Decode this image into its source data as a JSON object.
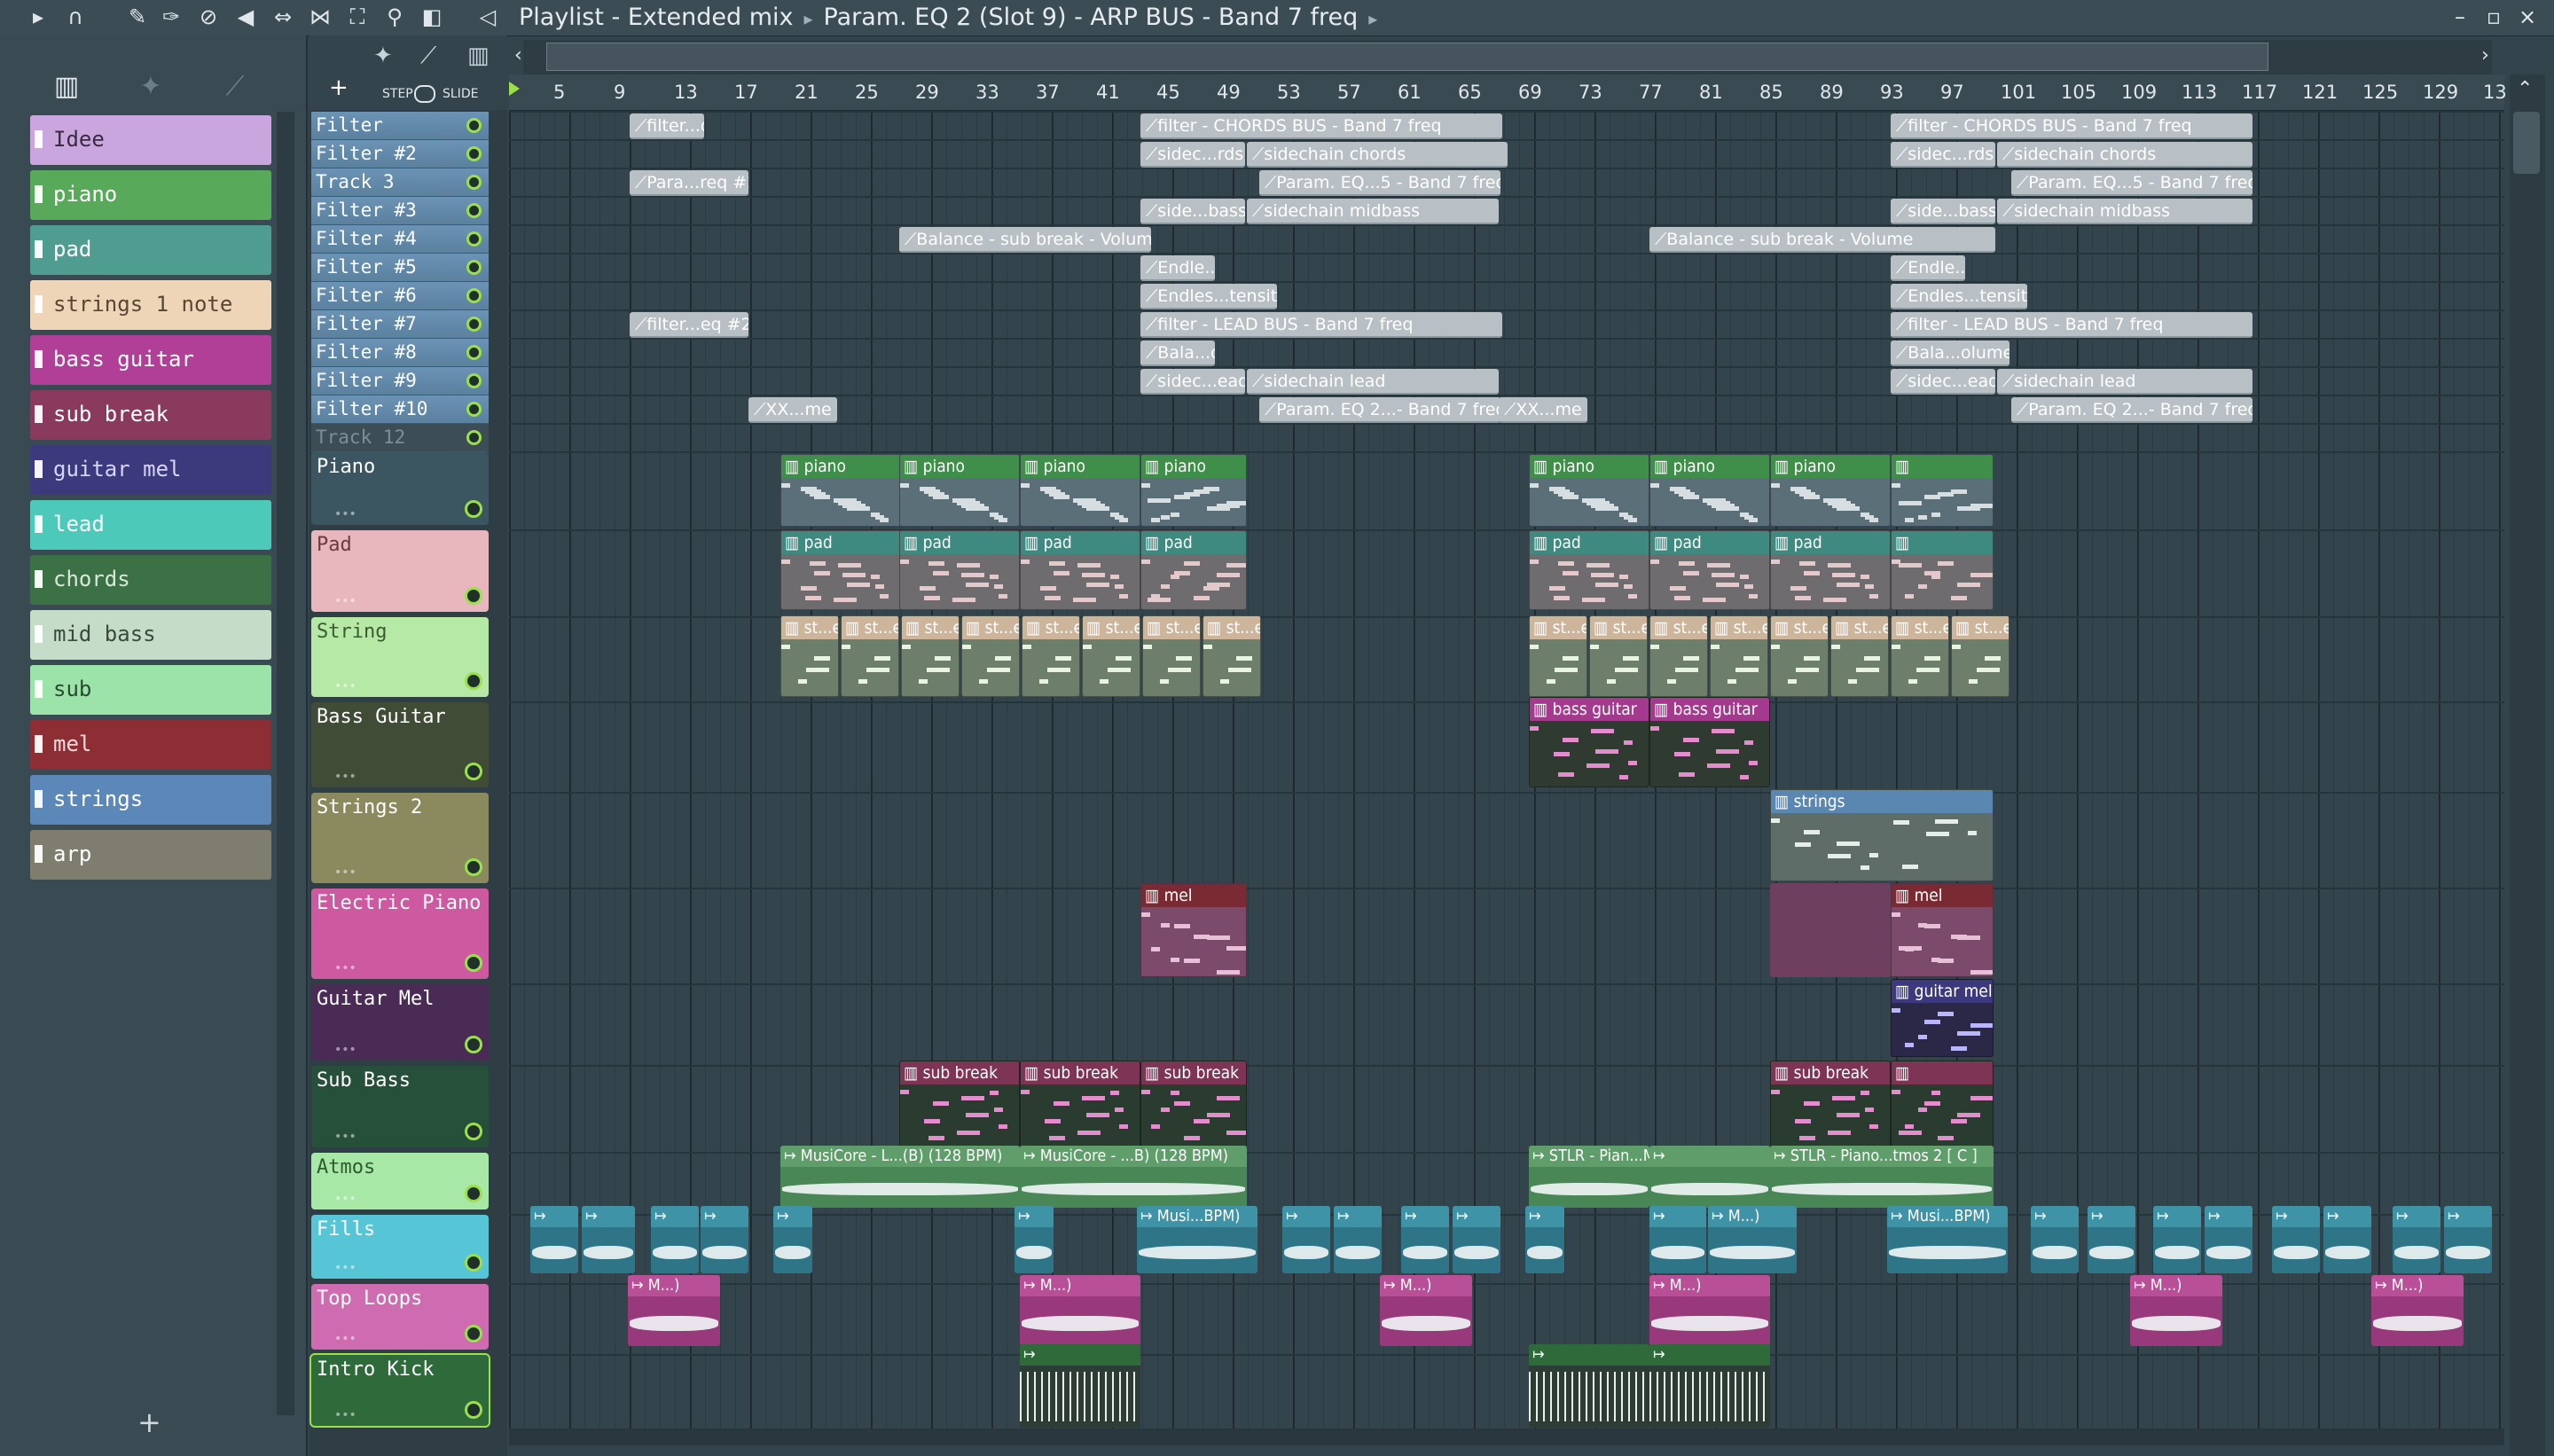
{
  "colors": {
    "accent": "#9be04a",
    "playlist_bg": "#34444d",
    "automation_clip": "#b8c0c6"
  },
  "topbar": {
    "icons": [
      "play-arrow-icon",
      "magnet-icon",
      "pencil-icon",
      "paint-brush-icon",
      "delete-icon",
      "mute-icon",
      "slip-icon",
      "slice-icon",
      "select-icon",
      "zoom-icon",
      "playback-icon",
      "speaker-icon"
    ],
    "title_main": "Playlist - Extended mix",
    "title_path": "Param. EQ 2 (Slot 9) - ARP BUS - Band 7 freq",
    "window": [
      "minimize-icon",
      "maximize-icon",
      "close-icon"
    ]
  },
  "snap": {
    "step_label": "STEP",
    "slide_label": "SLIDE"
  },
  "patterns": [
    {
      "label": "Idee",
      "color": "#c9a6de",
      "text": "#3a2a44"
    },
    {
      "label": "piano",
      "color": "#58a95a",
      "text": "#ffffff"
    },
    {
      "label": "pad",
      "color": "#4f9d91",
      "text": "#ffffff"
    },
    {
      "label": "strings 1 note",
      "color": "#eed5b8",
      "text": "#5a4632"
    },
    {
      "label": "bass guitar",
      "color": "#b13f98",
      "text": "#ffffff"
    },
    {
      "label": "sub break",
      "color": "#8a3a5c",
      "text": "#ffffff"
    },
    {
      "label": "guitar mel",
      "color": "#3c3a7c",
      "text": "#d7d5ff"
    },
    {
      "label": "lead",
      "color": "#4cc9b9",
      "text": "#ffffff"
    },
    {
      "label": "chords",
      "color": "#3c7146",
      "text": "#d7ead9"
    },
    {
      "label": "mid bass",
      "color": "#c5dcc8",
      "text": "#3a4a3d"
    },
    {
      "label": "sub",
      "color": "#9be3a9",
      "text": "#2a4a30"
    },
    {
      "label": "mel",
      "color": "#8d2e35",
      "text": "#ffd9d9"
    },
    {
      "label": "strings",
      "color": "#5b87b9",
      "text": "#ffffff"
    },
    {
      "label": "arp",
      "color": "#7e7d6e",
      "text": "#ffffff"
    }
  ],
  "ruler": [
    "5",
    "9",
    "13",
    "17",
    "21",
    "25",
    "29",
    "33",
    "37",
    "41",
    "45",
    "49",
    "53",
    "57",
    "61",
    "65",
    "69",
    "73",
    "77",
    "81",
    "85",
    "89",
    "93",
    "97",
    "101",
    "105",
    "109",
    "113",
    "117",
    "121",
    "125",
    "129",
    "13"
  ],
  "automation_tracks": [
    "Filter",
    "Filter #2",
    "Track 3",
    "Filter #3",
    "Filter #4",
    "Filter #5",
    "Filter #6",
    "Filter #7",
    "Filter #8",
    "Filter #9",
    "Filter #10",
    "Track 12"
  ],
  "tracks": [
    {
      "name": "Piano",
      "color": "#3b5661",
      "text": "#ffffff"
    },
    {
      "name": "Pad",
      "color": "#e7b7bd",
      "text": "#6a3a40"
    },
    {
      "name": "String",
      "color": "#b6e9a5",
      "text": "#3b5a31"
    },
    {
      "name": "Bass Guitar",
      "color": "#404c35",
      "text": "#ffffff"
    },
    {
      "name": "Strings 2",
      "color": "#8b8a5e",
      "text": "#ffffff"
    },
    {
      "name": "Electric Piano",
      "color": "#cd5aa1",
      "text": "#ffffff"
    },
    {
      "name": "Guitar Mel",
      "color": "#4a2b56",
      "text": "#ffffff"
    },
    {
      "name": "Sub Bass",
      "color": "#27503a",
      "text": "#ffffff"
    },
    {
      "name": "Atmos",
      "color": "#a7e8a7",
      "text": "#2f5a30"
    },
    {
      "name": "Fills",
      "color": "#56c5d6",
      "text": "#ffffff"
    },
    {
      "name": "Top Loops",
      "color": "#cf6bb1",
      "text": "#ffffff"
    },
    {
      "name": "Intro Kick",
      "color": "#2f6a3a",
      "text": "#ffffff"
    }
  ],
  "automation_clips": [
    {
      "label": "filter...q #2"
    },
    {
      "label": "filter - CHORDS BUS - Band 7 freq"
    },
    {
      "label": "filter - CHORDS BUS - Band 7 freq"
    },
    {
      "label": "sidec...rds"
    },
    {
      "label": "sidechain chords"
    },
    {
      "label": "sidec...rds"
    },
    {
      "label": "sidechain chords"
    },
    {
      "label": "Para...req #2"
    },
    {
      "label": "Param. EQ...5 - Band 7 freq"
    },
    {
      "label": "Param. EQ...5 - Band 7 freq"
    },
    {
      "label": "side...bass"
    },
    {
      "label": "sidechain midbass"
    },
    {
      "label": "side...bass"
    },
    {
      "label": "sidechain midbass"
    },
    {
      "label": "Balance - sub break - Volume"
    },
    {
      "label": "Balance - sub break - Volume"
    },
    {
      "label": "Endle...ensit"
    },
    {
      "label": "Endle...ensit"
    },
    {
      "label": "Endles...tensit"
    },
    {
      "label": "Endles...tensit"
    },
    {
      "label": "filter...eq #2"
    },
    {
      "label": "filter - LEAD BUS - Band 7 freq"
    },
    {
      "label": "filter - LEAD BUS - Band 7 freq"
    },
    {
      "label": "Bala...olume"
    },
    {
      "label": "Bala...olume"
    },
    {
      "label": "sidec...ead"
    },
    {
      "label": "sidechain lead"
    },
    {
      "label": "sidec...ead"
    },
    {
      "label": "sidechain lead"
    },
    {
      "label": "XX...me"
    },
    {
      "label": "Param. EQ 2...- Band 7 freq"
    },
    {
      "label": "XX...me"
    },
    {
      "label": "Param. EQ 2...- Band 7 freq"
    }
  ],
  "pattern_clips": {
    "piano": "piano",
    "pad": "pad",
    "string": "st...e",
    "bass": "bass guitar",
    "strings": "strings",
    "mel": "mel",
    "guitar": "guitar mel",
    "sub": "sub break",
    "atmos_1": "MusiCore - L...(B) (128 BPM)",
    "atmos_2": "MusiCore - ...B) (128 BPM)",
    "atmos_3": "STLR - Pian...M",
    "atmos_4": "STLR - Piano...tmos 2 [ C ]",
    "fill_long": "Musi...BPM)",
    "fill_mm": "M...)",
    "fill_short": ""
  }
}
